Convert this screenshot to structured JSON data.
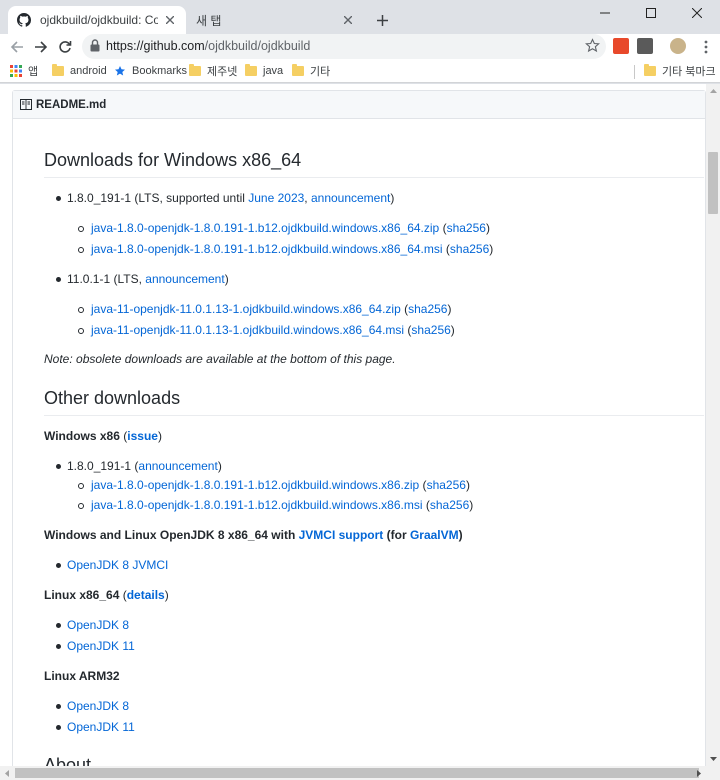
{
  "browser": {
    "tabs": [
      {
        "title": "ojdkbuild/ojdkbuild: Community",
        "active": true
      },
      {
        "title": "새 탭",
        "active": false
      }
    ],
    "url_host": "https://github.com",
    "url_path": "/ojdkbuild/ojdkbuild",
    "bookmarks": [
      "앱",
      "android",
      "Bookmarks",
      "제주넷",
      "java",
      "기타"
    ],
    "other_bookmarks": "기타 북마크"
  },
  "readme": {
    "filename": "README.md",
    "windows64": {
      "heading": "Downloads for Windows x86_64",
      "jdk8": {
        "version": "1.8.0_191-1",
        "pre": " (LTS, supported until ",
        "until_link": "June 2023",
        "comma": ", ",
        "announce_link": "announcement",
        "post": ")",
        "files": [
          {
            "name": "java-1.8.0-openjdk-1.8.0.191-1.b12.ojdkbuild.windows.x86_64.zip",
            "sha": "sha256"
          },
          {
            "name": "java-1.8.0-openjdk-1.8.0.191-1.b12.ojdkbuild.windows.x86_64.msi",
            "sha": "sha256"
          }
        ]
      },
      "jdk11": {
        "version": "11.0.1-1",
        "pre": " (LTS, ",
        "announce_link": "announcement",
        "post": ")",
        "files": [
          {
            "name": "java-11-openjdk-11.0.1.13-1.ojdkbuild.windows.x86_64.zip",
            "sha": "sha256"
          },
          {
            "name": "java-11-openjdk-11.0.1.13-1.ojdkbuild.windows.x86_64.msi",
            "sha": "sha256"
          }
        ]
      },
      "note": "Note: obsolete downloads are available at the bottom of this page."
    },
    "other": {
      "heading": "Other downloads",
      "win86": {
        "label": "Windows x86",
        "issue_link": "issue",
        "version": "1.8.0_191-1",
        "announce_link": "announcement",
        "files": [
          {
            "name": "java-1.8.0-openjdk-1.8.0.191-1.b12.ojdkbuild.windows.x86.zip",
            "sha": "sha256"
          },
          {
            "name": "java-1.8.0-openjdk-1.8.0.191-1.b12.ojdkbuild.windows.x86.msi",
            "sha": "sha256"
          }
        ]
      },
      "jvmci": {
        "label": "Windows and Linux OpenJDK 8 x86_64 with ",
        "jvmci_link": "JVMCI support",
        "mid": " (for ",
        "graal_link": "GraalVM",
        "post": ")",
        "item": "OpenJDK 8 JVMCI"
      },
      "linux64": {
        "label": "Linux x86_64",
        "details_link": "details",
        "items": [
          "OpenJDK 8",
          "OpenJDK 11"
        ]
      },
      "arm32": {
        "label": "Linux ARM32",
        "items": [
          "OpenJDK 8",
          "OpenJDK 11"
        ]
      }
    },
    "about_heading": "About"
  }
}
